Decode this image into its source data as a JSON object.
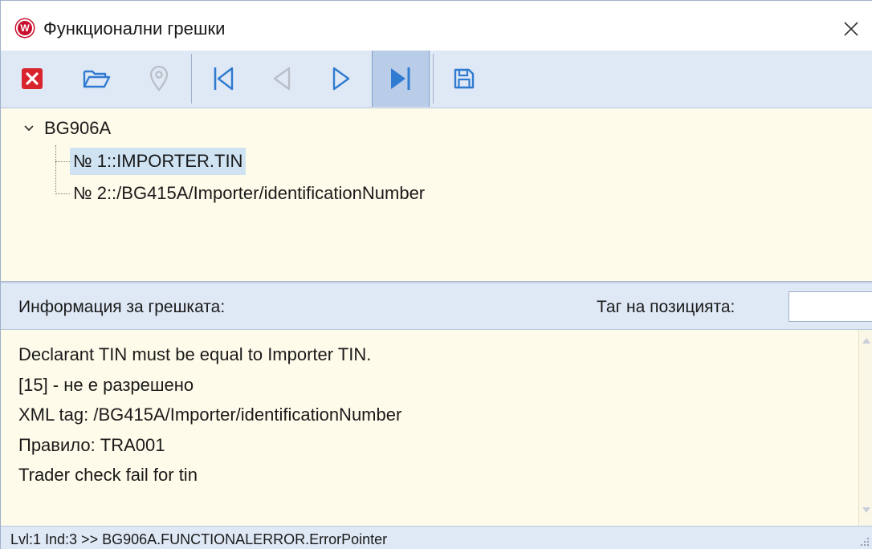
{
  "window": {
    "title": "Функционални грешки",
    "logo_letter": "W"
  },
  "toolbar": {
    "buttons": [
      {
        "name": "close-errors",
        "icon": "red-x-icon",
        "enabled": true
      },
      {
        "name": "open",
        "icon": "folder-open-icon",
        "enabled": true
      },
      {
        "name": "locate",
        "icon": "map-pin-icon",
        "enabled": false
      },
      {
        "name": "first",
        "icon": "skip-first-icon",
        "enabled": true
      },
      {
        "name": "previous",
        "icon": "previous-icon",
        "enabled": false
      },
      {
        "name": "next",
        "icon": "next-icon",
        "enabled": true
      },
      {
        "name": "last",
        "icon": "skip-last-icon",
        "enabled": true,
        "active": true
      },
      {
        "name": "save",
        "icon": "save-icon",
        "enabled": true
      }
    ]
  },
  "tree": {
    "root": "BG906A",
    "children": [
      {
        "label": "№  1::IMPORTER.TIN",
        "selected": true
      },
      {
        "label": "№  2::/BG415A/Importer/identificationNumber",
        "selected": false
      }
    ]
  },
  "info": {
    "label": "Информация за грешката:",
    "tag_label": "Таг на позицията:",
    "tag_value": ""
  },
  "messages": [
    "Declarant TIN must be equal to Importer TIN.",
    "[15] - не е разрешено",
    "XML tag: /BG415A/Importer/identificationNumber",
    "Правило: TRA001",
    "Trader check fail for  tin"
  ],
  "status": {
    "text": "Lvl:1 Ind:3 >> BG906A.FUNCTIONALERROR.ErrorPointer"
  },
  "colors": {
    "accent": "#2f7bd1",
    "danger": "#d9232d",
    "selection": "#cfe3f3",
    "panel": "#fffbea",
    "chrome": "#dfe8f5"
  }
}
